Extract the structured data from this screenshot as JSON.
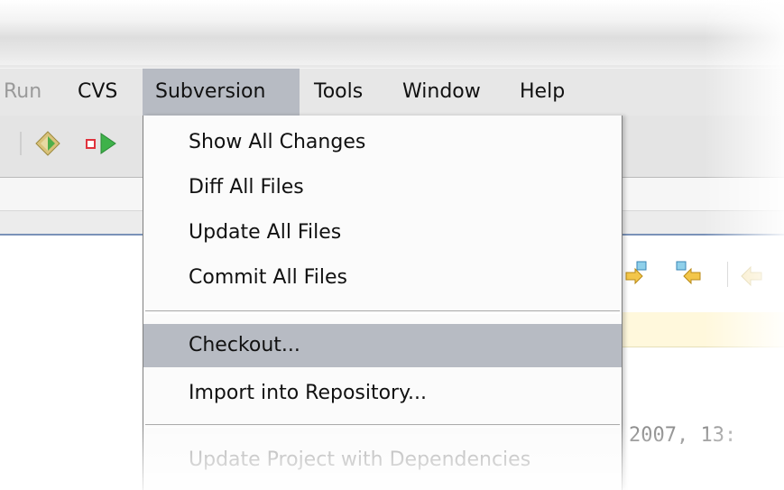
{
  "menubar": {
    "items": [
      {
        "label": "Run"
      },
      {
        "label": "CVS"
      },
      {
        "label": "Subversion"
      },
      {
        "label": "Tools"
      },
      {
        "label": "Window"
      },
      {
        "label": "Help"
      }
    ],
    "active": "Subversion"
  },
  "toolbar": {
    "icons": [
      "debug-diamond-icon",
      "run-arrow-icon"
    ]
  },
  "editor_toolbar": {
    "icons": [
      "next-diff-icon",
      "previous-diff-icon",
      "arrow-left-icon"
    ]
  },
  "subversion_menu": {
    "items": [
      {
        "label": "Show All Changes",
        "state": "enabled"
      },
      {
        "label": "Diff All Files",
        "state": "enabled"
      },
      {
        "label": "Update All Files",
        "state": "enabled"
      },
      {
        "label": "Commit All Files",
        "state": "enabled"
      },
      {
        "label": "Checkout...",
        "state": "highlighted"
      },
      {
        "label": "Import into Repository...",
        "state": "enabled"
      },
      {
        "label": "Update Project with Dependencies",
        "state": "disabled"
      }
    ]
  },
  "editor": {
    "visible_text": "2007, 13:",
    "faint_tail": ":"
  },
  "colors": {
    "menu_highlight": "#b7bbc3",
    "menubar_bg": "#e7e7e7",
    "disabled_text": "#a8a8a8",
    "editor_text": "#8a8a8a",
    "yellow_bar": "#fff8dc"
  }
}
